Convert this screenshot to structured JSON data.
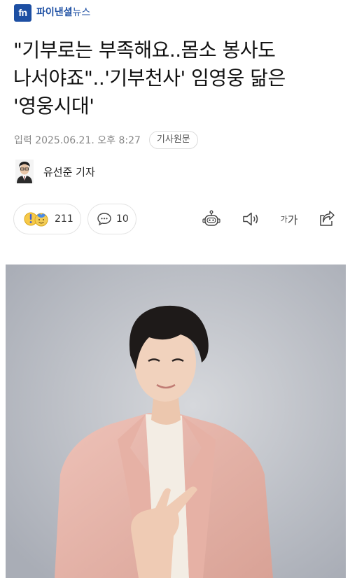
{
  "header": {
    "logo_mark": "fn",
    "logo_name_bold": "파이낸셜",
    "logo_name_light": "뉴스"
  },
  "article": {
    "headline_line1": "\"기부로는 부족해요..몸소 봉사도",
    "headline_line2": "나서야죠\"..'기부천사' 임영웅 닮은",
    "headline_line3": "'영웅시대'",
    "published": "입력 2025.06.21. 오후 8:27",
    "original_label": "기사원문",
    "reporter": "유선준 기자"
  },
  "actions": {
    "reaction_count": "211",
    "comment_count": "10",
    "font_small": "가",
    "font_large": "가"
  },
  "icons": [
    "reaction-emoji-icon",
    "comment-icon",
    "robot-icon",
    "speaker-icon",
    "font-size-icon",
    "share-icon"
  ],
  "colors": {
    "brand": "#1d4fa3",
    "meta_text": "#888888",
    "pill_border": "#e2e2e2"
  }
}
